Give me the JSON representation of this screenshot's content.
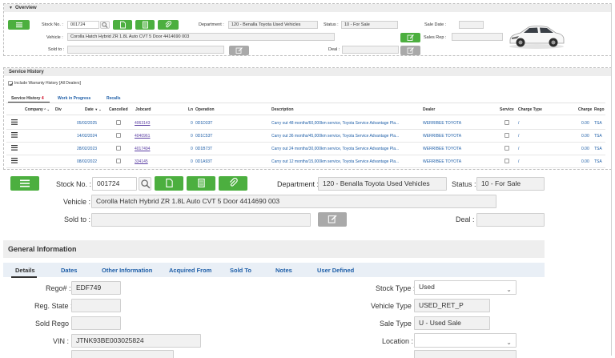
{
  "overview": {
    "title": "Overview",
    "stock_no_label": "Stock No. :",
    "stock_no_value": "001724",
    "department_label": "Department :",
    "department_value": "120 - Benalla Toyota Used Vehicles",
    "status_label": "Status :",
    "status_value": "10 - For Sale",
    "sale_date_label": "Sale Date :",
    "sale_date_value": "",
    "vehicle_label": "Vehicle :",
    "vehicle_value": "Corolla Hatch Hybrid ZR 1.8L Auto CVT 5 Door 4414690 003",
    "sales_rep_label": "Sales Rep :",
    "sales_rep_value": "",
    "sold_to_label": "Sold to :",
    "sold_to_value": "",
    "deal_label": "Deal :",
    "deal_value": ""
  },
  "service_history": {
    "title": "Service History",
    "include_warranty_label": "Include Warranty History [All Dealers]",
    "tabs": [
      "Service History",
      "Work in Progress",
      "Recalls"
    ],
    "tab_badge": "4",
    "columns": {
      "company": "Company",
      "div": "Div",
      "date": "Date",
      "cancelled": "Cancelled",
      "jobcard": "Jobcard",
      "ln": "Ln",
      "operation": "Operation",
      "description": "Description",
      "dealer": "Dealer",
      "service": "Service",
      "charge_type": "Charge Type",
      "charge": "Charge",
      "rego": "Rego"
    },
    "rows": [
      {
        "date": "05/02/2025",
        "jobcard": "4063143",
        "ln": "0",
        "operation": "0D1D33T",
        "description": "Carry out 48 months/60,000km service, Toyota Service Advantage Pla...",
        "dealer": "WERRIBEE TOYOTA",
        "charge_type": "/",
        "charge": "0.00",
        "rego": "TSA"
      },
      {
        "date": "14/02/2024",
        "jobcard": "4040961",
        "ln": "0",
        "operation": "0D1C53T",
        "description": "Carry out 36 months/45,000km service, Toyota Service Advantage Pla...",
        "dealer": "WERRIBEE TOYOTA",
        "charge_type": "/",
        "charge": "0.00",
        "rego": "TSA"
      },
      {
        "date": "28/02/2023",
        "jobcard": "4017494",
        "ln": "0",
        "operation": "0D1B73T",
        "description": "Carry out 24 months/30,000km service, Toyota Service Advantage Pla...",
        "dealer": "WERRIBEE TOYOTA",
        "charge_type": "/",
        "charge": "0.00",
        "rego": "TSA"
      },
      {
        "date": "08/02/2022",
        "jobcard": "334145",
        "ln": "0",
        "operation": "0D1A93T",
        "description": "Carry out 12 months/15,000km service, Toyota Service Advantage Pla...",
        "dealer": "WERRIBEE TOYOTA",
        "charge_type": "/",
        "charge": "0.00",
        "rego": "TSA"
      }
    ]
  },
  "form": {
    "stock_no_label": "Stock No. :",
    "stock_no_value": "001724",
    "department_label": "Department :",
    "department_value": "120 - Benalla Toyota Used Vehicles",
    "status_label": "Status :",
    "status_value": "10 - For Sale",
    "vehicle_label": "Vehicle :",
    "vehicle_value": "Corolla Hatch Hybrid ZR 1.8L Auto CVT 5 Door 4414690 003",
    "sold_to_label": "Sold to :",
    "sold_to_value": "",
    "deal_label": "Deal :",
    "deal_value": ""
  },
  "general_info": {
    "title": "General Information",
    "tabs": [
      "Details",
      "Dates",
      "Other Information",
      "Acquired From",
      "Sold To",
      "Notes",
      "User Defined"
    ],
    "rego_label": "Rego# :",
    "rego_value": "EDF749",
    "reg_state_label": "Reg. State :",
    "reg_state_value": "",
    "sold_rego_label": "Sold Rego :",
    "sold_rego_value": "",
    "vin_label": "VIN :",
    "vin_value": "JTNK93BE003025824",
    "stock_type_label": "Stock Type :",
    "stock_type_value": "Used",
    "vehicle_type_label": "Vehicle Type :",
    "vehicle_type_value": "USED_RET_P",
    "sale_type_label": "Sale Type :",
    "sale_type_value": "U - Used Sale",
    "location_label": "Location :",
    "location_value": ""
  },
  "colors": {
    "accent_green": "#4caf3f",
    "link_blue": "#1f5fa8",
    "tab_badge_red": "#d0021b",
    "car_body": "#ffffff"
  }
}
